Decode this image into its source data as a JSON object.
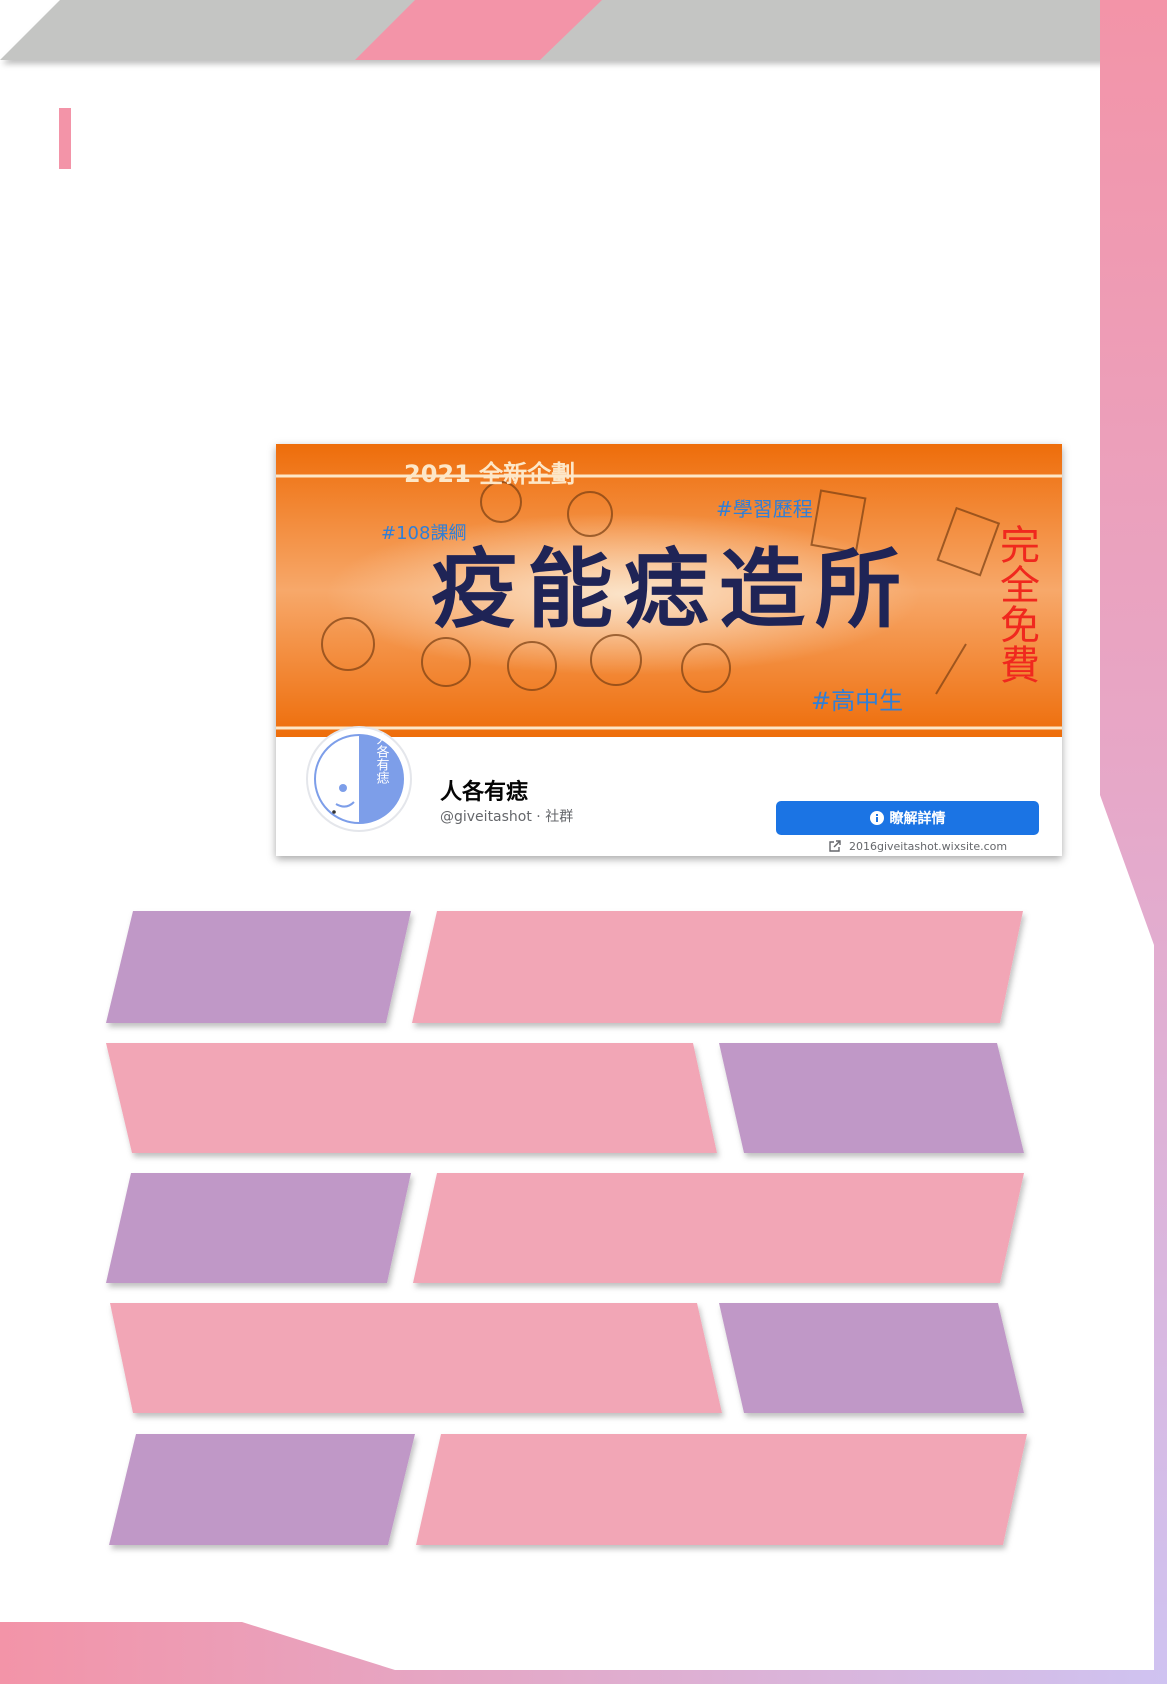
{
  "colors": {
    "pink": "#f394a8",
    "light_pink": "#f2a6b6",
    "purple": "#c098c7",
    "gray": "#c4c5c3",
    "lavender": "#cfc3f1",
    "fb_blue": "#1b74e4",
    "orange": "#f07a12"
  },
  "fb_page": {
    "cover": {
      "tagline": "2021 全新企劃",
      "title": "疫能痣造所",
      "tag_course": "#108課綱",
      "tag_portfolio": "#學習歷程",
      "tag_student": "#高中生",
      "free_label": "完全免費"
    },
    "avatar_text": "人各有痣",
    "page_name": "人各有痣",
    "handle": "@giveitashot · 社群",
    "cta_button": "瞭解詳情",
    "website": "2016giveitashot.wixsite.com"
  },
  "icons": {
    "info": "info-icon",
    "external": "external-link-icon"
  }
}
